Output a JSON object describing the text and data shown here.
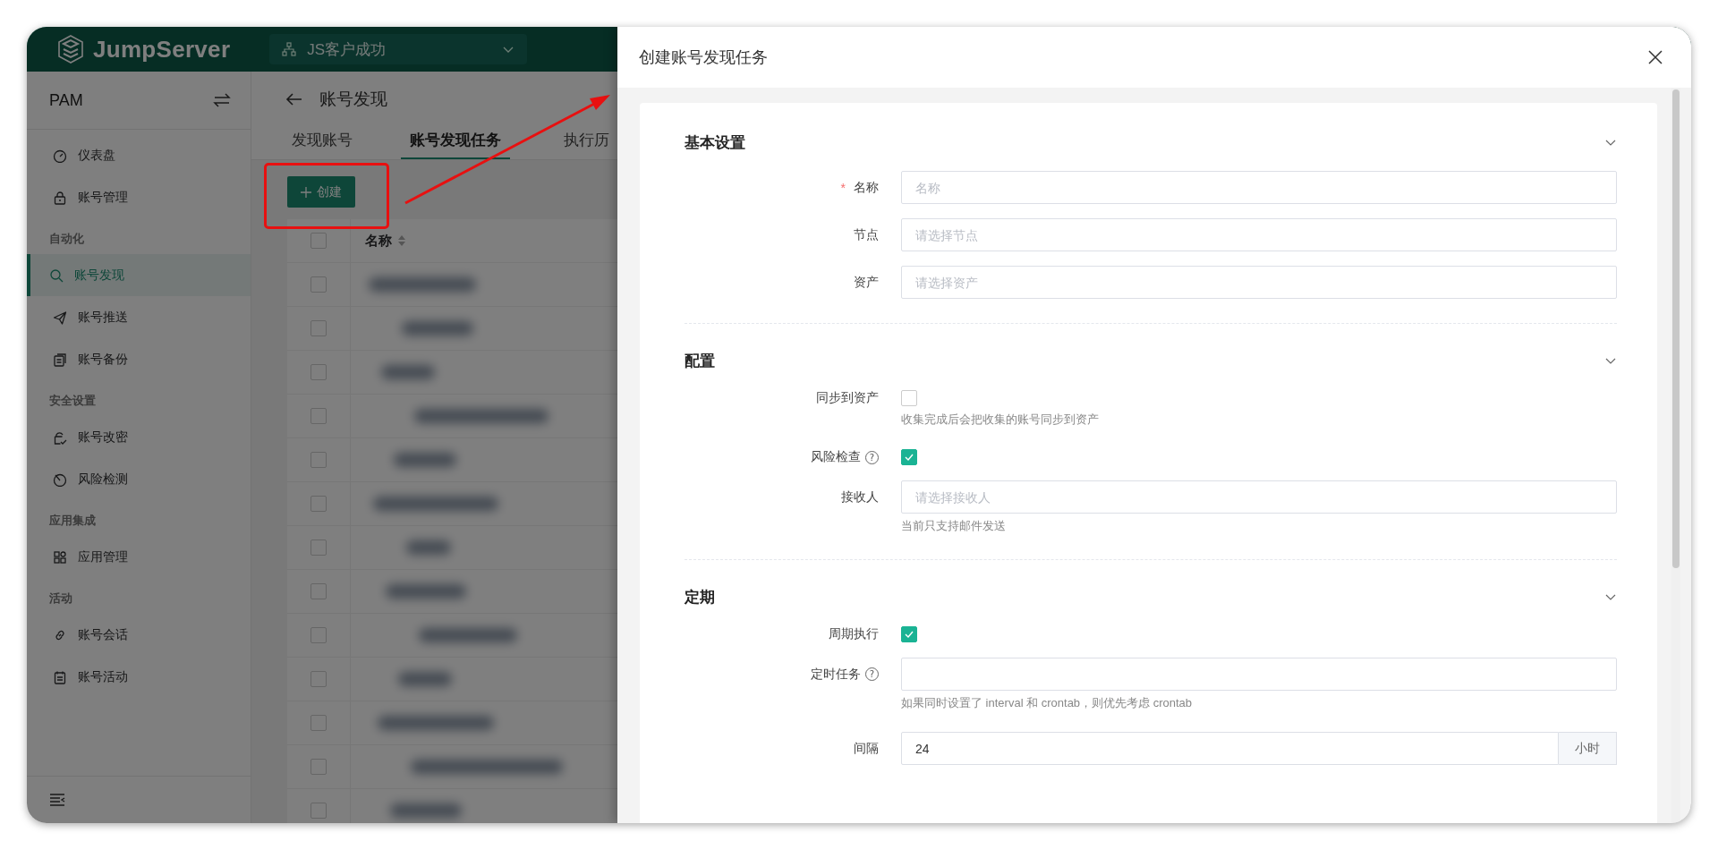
{
  "header": {
    "logo": "JumpServer",
    "org_selector": "JS客户成功"
  },
  "sidebar": {
    "title": "PAM",
    "items": [
      {
        "kind": "item",
        "label": "仪表盘",
        "selected": false
      },
      {
        "kind": "item",
        "label": "账号管理",
        "selected": false
      },
      {
        "kind": "group",
        "label": "自动化"
      },
      {
        "kind": "item",
        "label": "账号发现",
        "selected": true
      },
      {
        "kind": "item",
        "label": "账号推送",
        "selected": false
      },
      {
        "kind": "item",
        "label": "账号备份",
        "selected": false
      },
      {
        "kind": "group",
        "label": "安全设置"
      },
      {
        "kind": "item",
        "label": "账号改密",
        "selected": false
      },
      {
        "kind": "item",
        "label": "风险检测",
        "selected": false
      },
      {
        "kind": "group",
        "label": "应用集成"
      },
      {
        "kind": "item",
        "label": "应用管理",
        "selected": false
      },
      {
        "kind": "group",
        "label": "活动"
      },
      {
        "kind": "item",
        "label": "账号会话",
        "selected": false
      },
      {
        "kind": "item",
        "label": "账号活动",
        "selected": false
      }
    ]
  },
  "page": {
    "title": "账号发现",
    "tabs": [
      {
        "label": "发现账号",
        "selected": false
      },
      {
        "label": "账号发现任务",
        "selected": true
      },
      {
        "label": "执行历",
        "selected": false
      }
    ],
    "create_button": "创建",
    "table": {
      "header_checked": false,
      "columns": [
        {
          "label": "名称"
        }
      ],
      "rows": [
        {
          "checked": false
        },
        {
          "checked": false
        },
        {
          "checked": false
        },
        {
          "checked": false
        },
        {
          "checked": false
        },
        {
          "checked": false
        },
        {
          "checked": false
        },
        {
          "checked": false
        },
        {
          "checked": false
        },
        {
          "checked": false
        },
        {
          "checked": false
        },
        {
          "checked": false
        },
        {
          "checked": false
        }
      ]
    }
  },
  "drawer": {
    "title": "创建账号发现任务",
    "sections": [
      {
        "title": "基本设置",
        "expanded": true,
        "fields": [
          {
            "kind": "input",
            "label": "名称",
            "required_mark": "*",
            "placeholder": "名称"
          },
          {
            "kind": "input",
            "label": "节点",
            "placeholder": "请选择节点"
          },
          {
            "kind": "input",
            "label": "资产",
            "placeholder": "请选择资产"
          }
        ]
      },
      {
        "title": "配置",
        "expanded": true,
        "fields": [
          {
            "kind": "checkbox",
            "label": "同步到资产",
            "checked": false,
            "hint": "收集完成后会把收集的账号同步到资产"
          },
          {
            "kind": "checkbox",
            "label": "风险检查",
            "help": "?",
            "checked": true
          },
          {
            "kind": "input",
            "label": "接收人",
            "placeholder": "请选择接收人",
            "hint": "当前只支持邮件发送"
          }
        ]
      },
      {
        "title": "定期",
        "expanded": true,
        "fields": [
          {
            "kind": "checkbox",
            "label": "周期执行",
            "checked": true
          },
          {
            "kind": "input",
            "label": "定时任务",
            "help": "?",
            "hint": "如果同时设置了 interval 和 crontab，则优先考虑 crontab"
          },
          {
            "kind": "input",
            "label": "间隔",
            "value": "24",
            "addon": "小时"
          }
        ]
      }
    ]
  }
}
